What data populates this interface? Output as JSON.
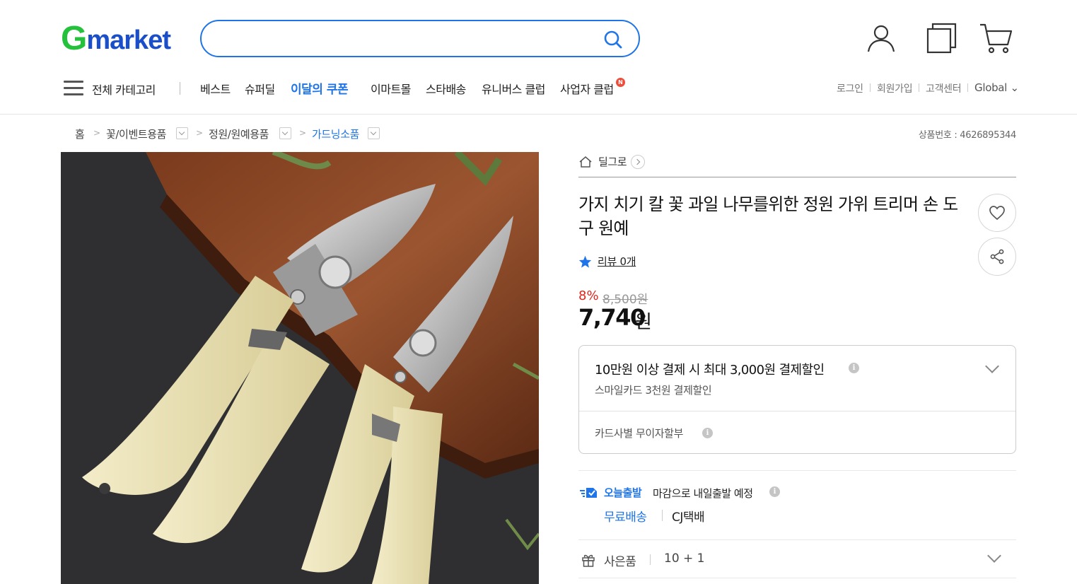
{
  "header": {
    "logo_g": "G",
    "logo_rest": "market",
    "search_placeholder": "",
    "search_value": ""
  },
  "nav": {
    "all_categories": "전체 카테고리",
    "items": [
      {
        "label": "베스트",
        "highlight": false
      },
      {
        "label": "슈퍼딜",
        "highlight": false
      },
      {
        "label": "이달의 쿠폰",
        "highlight": true
      },
      {
        "label": "이마트몰",
        "highlight": false
      },
      {
        "label": "스타배송",
        "highlight": false
      },
      {
        "label": "유니버스 클럽",
        "highlight": false
      },
      {
        "label": "사업자 클럽",
        "highlight": false
      }
    ],
    "new_badge": "N",
    "utility": [
      "로그인",
      "회원가입",
      "고객센터",
      "Global ⌄"
    ]
  },
  "breadcrumb": {
    "items": [
      "홈",
      "꽃/이벤트용품",
      "정원/원예용품",
      "가드닝소품"
    ],
    "product_number": "상품번호 : 4626895344"
  },
  "product": {
    "deal_link": "딜그로",
    "title": "가지 치기 칼 꽃 과일 나무를위한 정원 가위 트리머 손 도구 원예",
    "review_label": "리뷰 0개",
    "review_count": 0,
    "discount_rate": "8%",
    "original_price": "8,500원",
    "price": "7,740",
    "price_unit": "원"
  },
  "payment": {
    "main": "10만원 이상 결제 시 최대 3,000원 결제할인",
    "sub": "스마일카드 3천원 결제할인",
    "installment": "카드사별 무이자할부"
  },
  "shipping": {
    "tag": "오늘출발",
    "text": "마감으로 내일출발 예정",
    "free": "무료배송",
    "carrier": "CJ택배"
  },
  "gift": {
    "label": "사은품",
    "value": "10 + 1"
  },
  "colors": {
    "brand_green": "#25c03c",
    "brand_blue": "#1a4fc9",
    "accent_blue": "#1e74e8",
    "sale_red": "#e1251b"
  }
}
